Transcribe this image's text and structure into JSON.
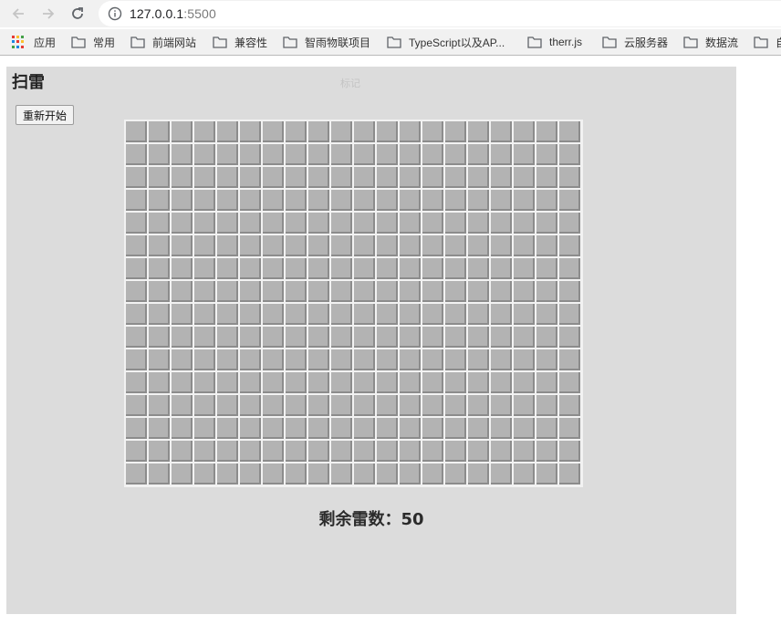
{
  "browser": {
    "url_host": "127.0.0.1",
    "url_port": ":5500",
    "bookmarks": [
      {
        "label": "应用",
        "icon": "apps-grid-icon"
      },
      {
        "label": "常用",
        "icon": "folder-icon"
      },
      {
        "label": "前端网站",
        "icon": "folder-icon"
      },
      {
        "label": "兼容性",
        "icon": "folder-icon"
      },
      {
        "label": "智雨物联项目",
        "icon": "folder-icon"
      },
      {
        "label": "TypeScript以及AP...",
        "icon": "folder-icon"
      },
      {
        "label": "therr.js",
        "icon": "folder-icon"
      },
      {
        "label": "云服务器",
        "icon": "folder-icon"
      },
      {
        "label": "数据流",
        "icon": "folder-icon"
      },
      {
        "label": "自",
        "icon": "folder-icon"
      }
    ]
  },
  "game": {
    "title": "扫雷",
    "mark_hint": "标记",
    "restart_label": "重新开始",
    "board": {
      "rows": 16,
      "cols": 20,
      "cell_state": "unrevealed"
    },
    "mines_remaining_label": "剩余雷数：",
    "mines_remaining": "50"
  },
  "colors": {
    "panel_bg": "#dcdcdc",
    "cell_face": "#b3b3b3",
    "cell_shadow": "#8c8c8c"
  }
}
